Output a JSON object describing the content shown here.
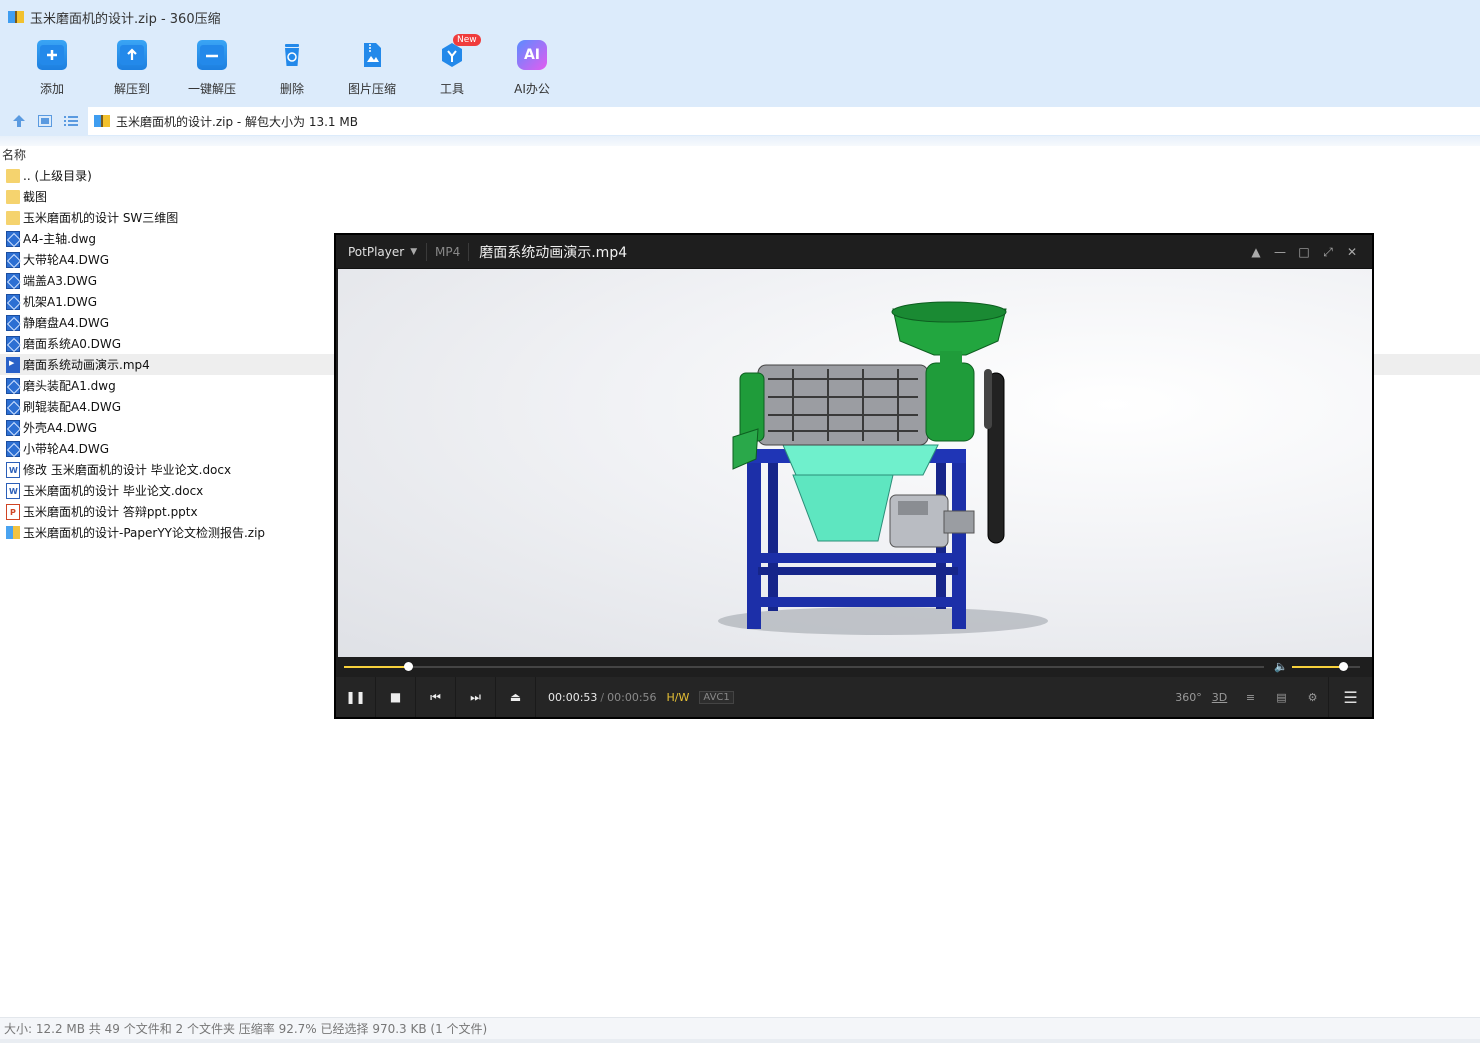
{
  "window": {
    "title": "玉米磨面机的设计.zip - 360压缩"
  },
  "toolbar": {
    "items": [
      {
        "label": "添加",
        "icon": "add-icon"
      },
      {
        "label": "解压到",
        "icon": "extract-to-icon"
      },
      {
        "label": "一键解压",
        "icon": "one-click-extract-icon"
      },
      {
        "label": "删除",
        "icon": "delete-icon"
      },
      {
        "label": "图片压缩",
        "icon": "image-compress-icon"
      },
      {
        "label": "工具",
        "icon": "tools-icon",
        "badge": "New"
      },
      {
        "label": "AI办公",
        "icon": "ai-office-icon",
        "glyph": "AI"
      }
    ]
  },
  "address": {
    "text": "玉米磨面机的设计.zip - 解包大小为 13.1 MB"
  },
  "list": {
    "column_name": "名称",
    "rows": [
      {
        "name": ".. (上级目录)",
        "type": "folder"
      },
      {
        "name": "截图",
        "type": "folder"
      },
      {
        "name": "玉米磨面机的设计 SW三维图",
        "type": "folder"
      },
      {
        "name": "A4-主轴.dwg",
        "type": "dwg"
      },
      {
        "name": "大带轮A4.DWG",
        "type": "dwg"
      },
      {
        "name": "端盖A3.DWG",
        "type": "dwg"
      },
      {
        "name": "机架A1.DWG",
        "type": "dwg"
      },
      {
        "name": "静磨盘A4.DWG",
        "type": "dwg"
      },
      {
        "name": "磨面系统A0.DWG",
        "type": "dwg"
      },
      {
        "name": "磨面系统动画演示.mp4",
        "type": "mp4",
        "selected": true
      },
      {
        "name": "磨头装配A1.dwg",
        "type": "dwg"
      },
      {
        "name": "刷辊装配A4.DWG",
        "type": "dwg"
      },
      {
        "name": "外壳A4.DWG",
        "type": "dwg"
      },
      {
        "name": "小带轮A4.DWG",
        "type": "dwg"
      },
      {
        "name": "修改 玉米磨面机的设计 毕业论文.docx",
        "type": "docx"
      },
      {
        "name": "玉米磨面机的设计 毕业论文.docx",
        "type": "docx"
      },
      {
        "name": "玉米磨面机的设计 答辩ppt.pptx",
        "type": "pptx"
      },
      {
        "name": "玉米磨面机的设计-PaperYY论文检测报告.zip",
        "type": "zip"
      }
    ]
  },
  "status": {
    "text": "大小: 12.2 MB 共 49 个文件和 2 个文件夹 压缩率 92.7% 已经选择 970.3 KB (1 个文件)"
  },
  "player": {
    "brand": "PotPlayer",
    "format": "MP4",
    "filename": "磨面系统动画演示.mp4",
    "current_time": "00:00:53",
    "separator": "/",
    "total_time": "00:00:56",
    "hw_label": "H/W",
    "codec": "AVC1",
    "progress": 0.07,
    "volume": 0.75,
    "right_controls": [
      {
        "name": "360-view-button",
        "glyph": "360°"
      },
      {
        "name": "3d-button",
        "glyph": "3D"
      },
      {
        "name": "search-subtitle-button",
        "glyph": "≡"
      },
      {
        "name": "playlist-button",
        "glyph": "▤"
      },
      {
        "name": "settings-button",
        "glyph": "⚙"
      }
    ],
    "accent": "#f7d13c"
  },
  "colors": {
    "chrome_bg": "#dcebfb",
    "selected_row": "#eeeeee",
    "machine_frame": "#1c2fa8",
    "machine_green": "#1f9c3a",
    "hopper_cyan": "#5ee6c0"
  }
}
